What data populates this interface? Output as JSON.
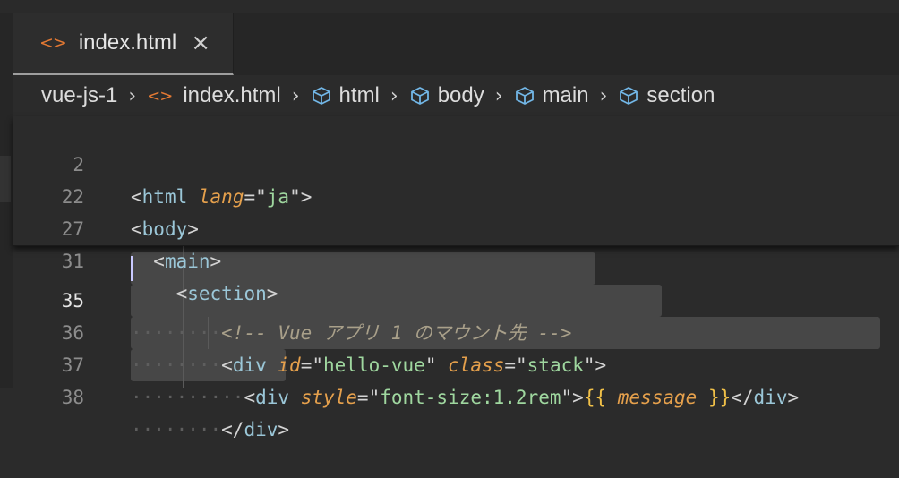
{
  "tab": {
    "icon": "<>",
    "label": "index.html",
    "close": "×"
  },
  "breadcrumb": {
    "items": [
      {
        "label": "vue-js-1",
        "icon": ""
      },
      {
        "label": "index.html",
        "icon": "code-icon"
      },
      {
        "label": "html",
        "icon": "cube-icon"
      },
      {
        "label": "body",
        "icon": "cube-icon"
      },
      {
        "label": "main",
        "icon": "cube-icon"
      },
      {
        "label": "section",
        "icon": "cube-icon"
      }
    ]
  },
  "sticky_lines": [
    {
      "num": "2",
      "tag": "html",
      "attr": "lang",
      "value": "ja"
    },
    {
      "num": "22",
      "tag": "body"
    },
    {
      "num": "27",
      "tag": "main"
    },
    {
      "num": "31",
      "tag": "section"
    }
  ],
  "lines": [
    {
      "num": "35",
      "comment": "<!-- Vue アプリ 1 のマウント先 -->"
    },
    {
      "num": "36",
      "tag": "div",
      "attr1": "id",
      "val1": "hello-vue",
      "attr2": "class",
      "val2": "stack"
    },
    {
      "num": "37",
      "tag": "div",
      "attr": "style",
      "val": "font-size:1.2rem",
      "var": "message",
      "close": "div"
    },
    {
      "num": "38",
      "close": "div"
    }
  ],
  "colors": {
    "accent_icon": "#e37933",
    "tag": "#9bc7d8",
    "attribute": "#e5a04c",
    "string": "#9fd79f",
    "brace": "#f0c048"
  }
}
